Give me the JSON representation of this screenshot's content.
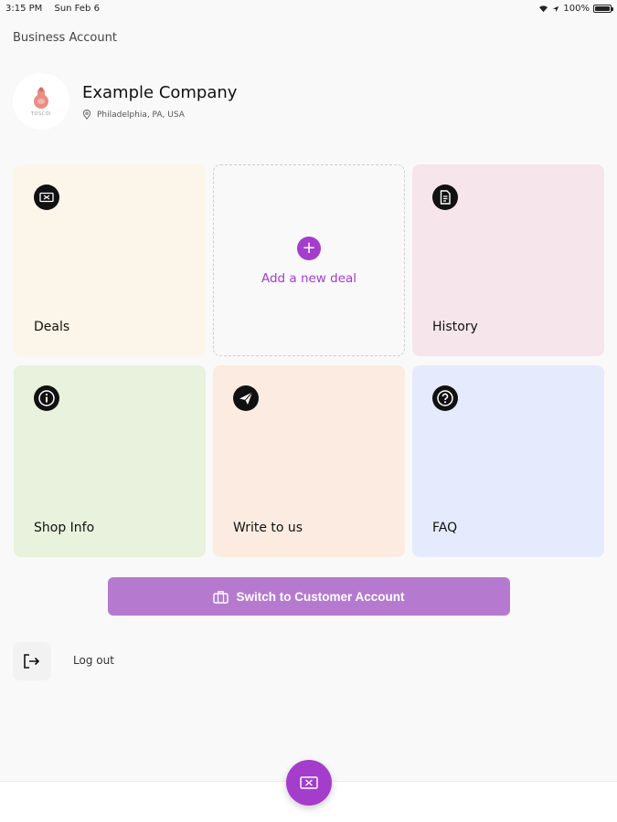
{
  "status_bar": {
    "time": "3:15 PM",
    "date": "Sun Feb 6",
    "battery": "100%"
  },
  "page_title": "Business Account",
  "company": {
    "name": "Example Company",
    "location": "Philadelphia, PA, USA",
    "logo_text": "TOSCOI"
  },
  "tiles": {
    "deals": {
      "label": "Deals",
      "icon": "ticket-icon"
    },
    "add_deal": {
      "label": "Add a new deal",
      "icon": "plus-icon"
    },
    "history": {
      "label": "History",
      "icon": "document-icon"
    },
    "shop_info": {
      "label": "Shop Info",
      "icon": "info-icon"
    },
    "write_to_us": {
      "label": "Write to us",
      "icon": "send-icon"
    },
    "faq": {
      "label": "FAQ",
      "icon": "question-icon"
    }
  },
  "switch_button": {
    "label": "Switch to Customer Account",
    "icon": "briefcase-icon"
  },
  "logout": {
    "label": "Log out",
    "icon": "logout-icon"
  },
  "fab": {
    "icon": "ticket-icon"
  },
  "colors": {
    "accent": "#a43dcc",
    "switch_button": "#b57ad0",
    "deals_tile": "#fcf5e9",
    "history_tile": "#f7e5ec",
    "shop_tile": "#e8f2dc",
    "write_tile": "#fcebe0",
    "faq_tile": "#e5ebfc"
  }
}
